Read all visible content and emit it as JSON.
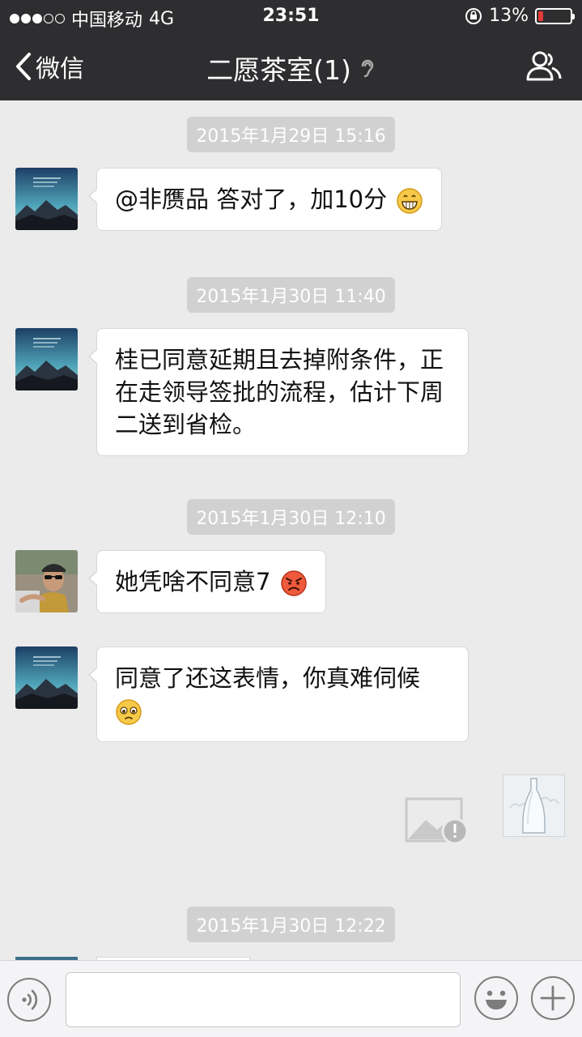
{
  "status_bar": {
    "carrier": "中国移动",
    "network": "4G",
    "time": "23:51",
    "battery": "13%",
    "battery_level": 0.13,
    "signal_bars": 3,
    "signal_total": 5
  },
  "nav": {
    "back_label": "微信",
    "title": "二愿茶室(1)"
  },
  "messages": [
    {
      "timestamp": "2015年1月29日 15:16",
      "text": "@非赝品 答对了，加10分",
      "emoji": "grin-face"
    },
    {
      "timestamp": "2015年1月30日 11:40",
      "text": "桂已同意延期且去掉附条件，正在走领导签批的流程，估计下周二送到省检。"
    },
    {
      "timestamp": "2015年1月30日 12:10",
      "text": "她凭啥不同意7",
      "emoji": "angry-face"
    },
    {
      "text": "同意了还这表情，你真难伺候",
      "emoji": "pleading-face"
    },
    {
      "timestamp": "2015年1月30日 12:22"
    }
  ],
  "input": {
    "value": "",
    "placeholder": ""
  },
  "colors": {
    "nav_bg": "#2e2e30",
    "chat_bg": "#ebebeb",
    "timestamp_bg": "#d1d1d1",
    "battery_low": "#e53935"
  }
}
